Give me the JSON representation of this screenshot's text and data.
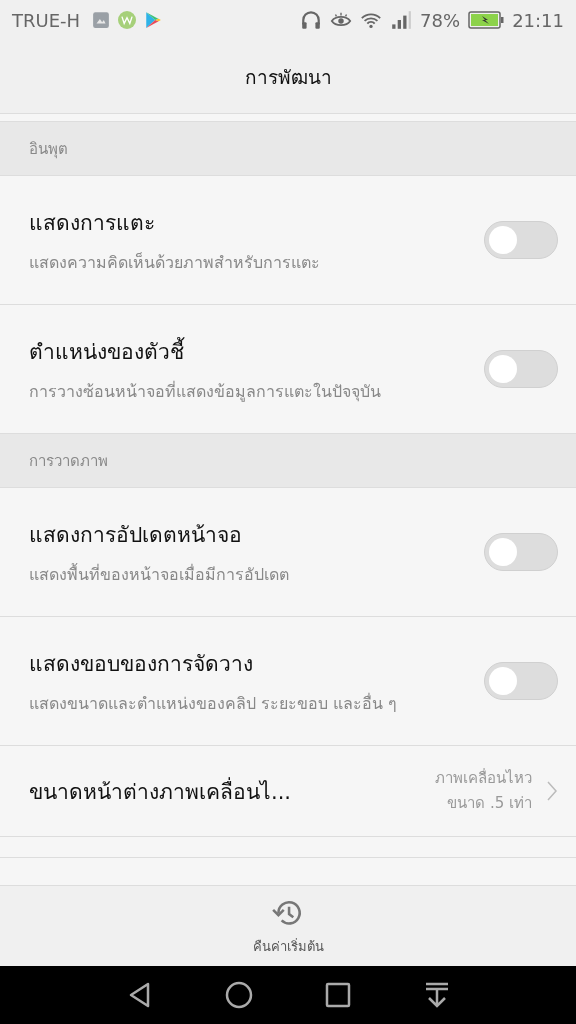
{
  "status_bar": {
    "carrier": "TRUE-H",
    "battery": "78%",
    "time": "21:11"
  },
  "title": "การพัฒนา",
  "sections": [
    {
      "header": "อินพุต",
      "items": [
        {
          "kind": "toggle",
          "title": "แสดงการแตะ",
          "subtitle": "แสดงความคิดเห็นด้วยภาพสำหรับการแตะ",
          "on": false
        },
        {
          "kind": "toggle",
          "title": "ตำแหน่งของตัวชี้",
          "subtitle": "การวางซ้อนหน้าจอที่แสดงข้อมูลการแตะในปัจจุบัน",
          "on": false
        }
      ]
    },
    {
      "header": "การวาดภาพ",
      "items": [
        {
          "kind": "toggle",
          "title": "แสดงการอัปเดตหน้าจอ",
          "subtitle": "แสดงพื้นที่ของหน้าจอเมื่อมีการอัปเดต",
          "on": false
        },
        {
          "kind": "toggle",
          "title": "แสดงขอบของการจัดวาง",
          "subtitle": "แสดงขนาดและตำแหน่งของคลิป ระยะขอบ และอื่น ๆ",
          "on": false
        },
        {
          "kind": "link",
          "title": "ขนาดหน้าต่างภาพเคลื่อนไ...",
          "value": "ภาพเคลื่อนไหว ขนาด .5 เท่า"
        }
      ]
    }
  ],
  "reset_label": "คืนค่าเริ่มต้น"
}
